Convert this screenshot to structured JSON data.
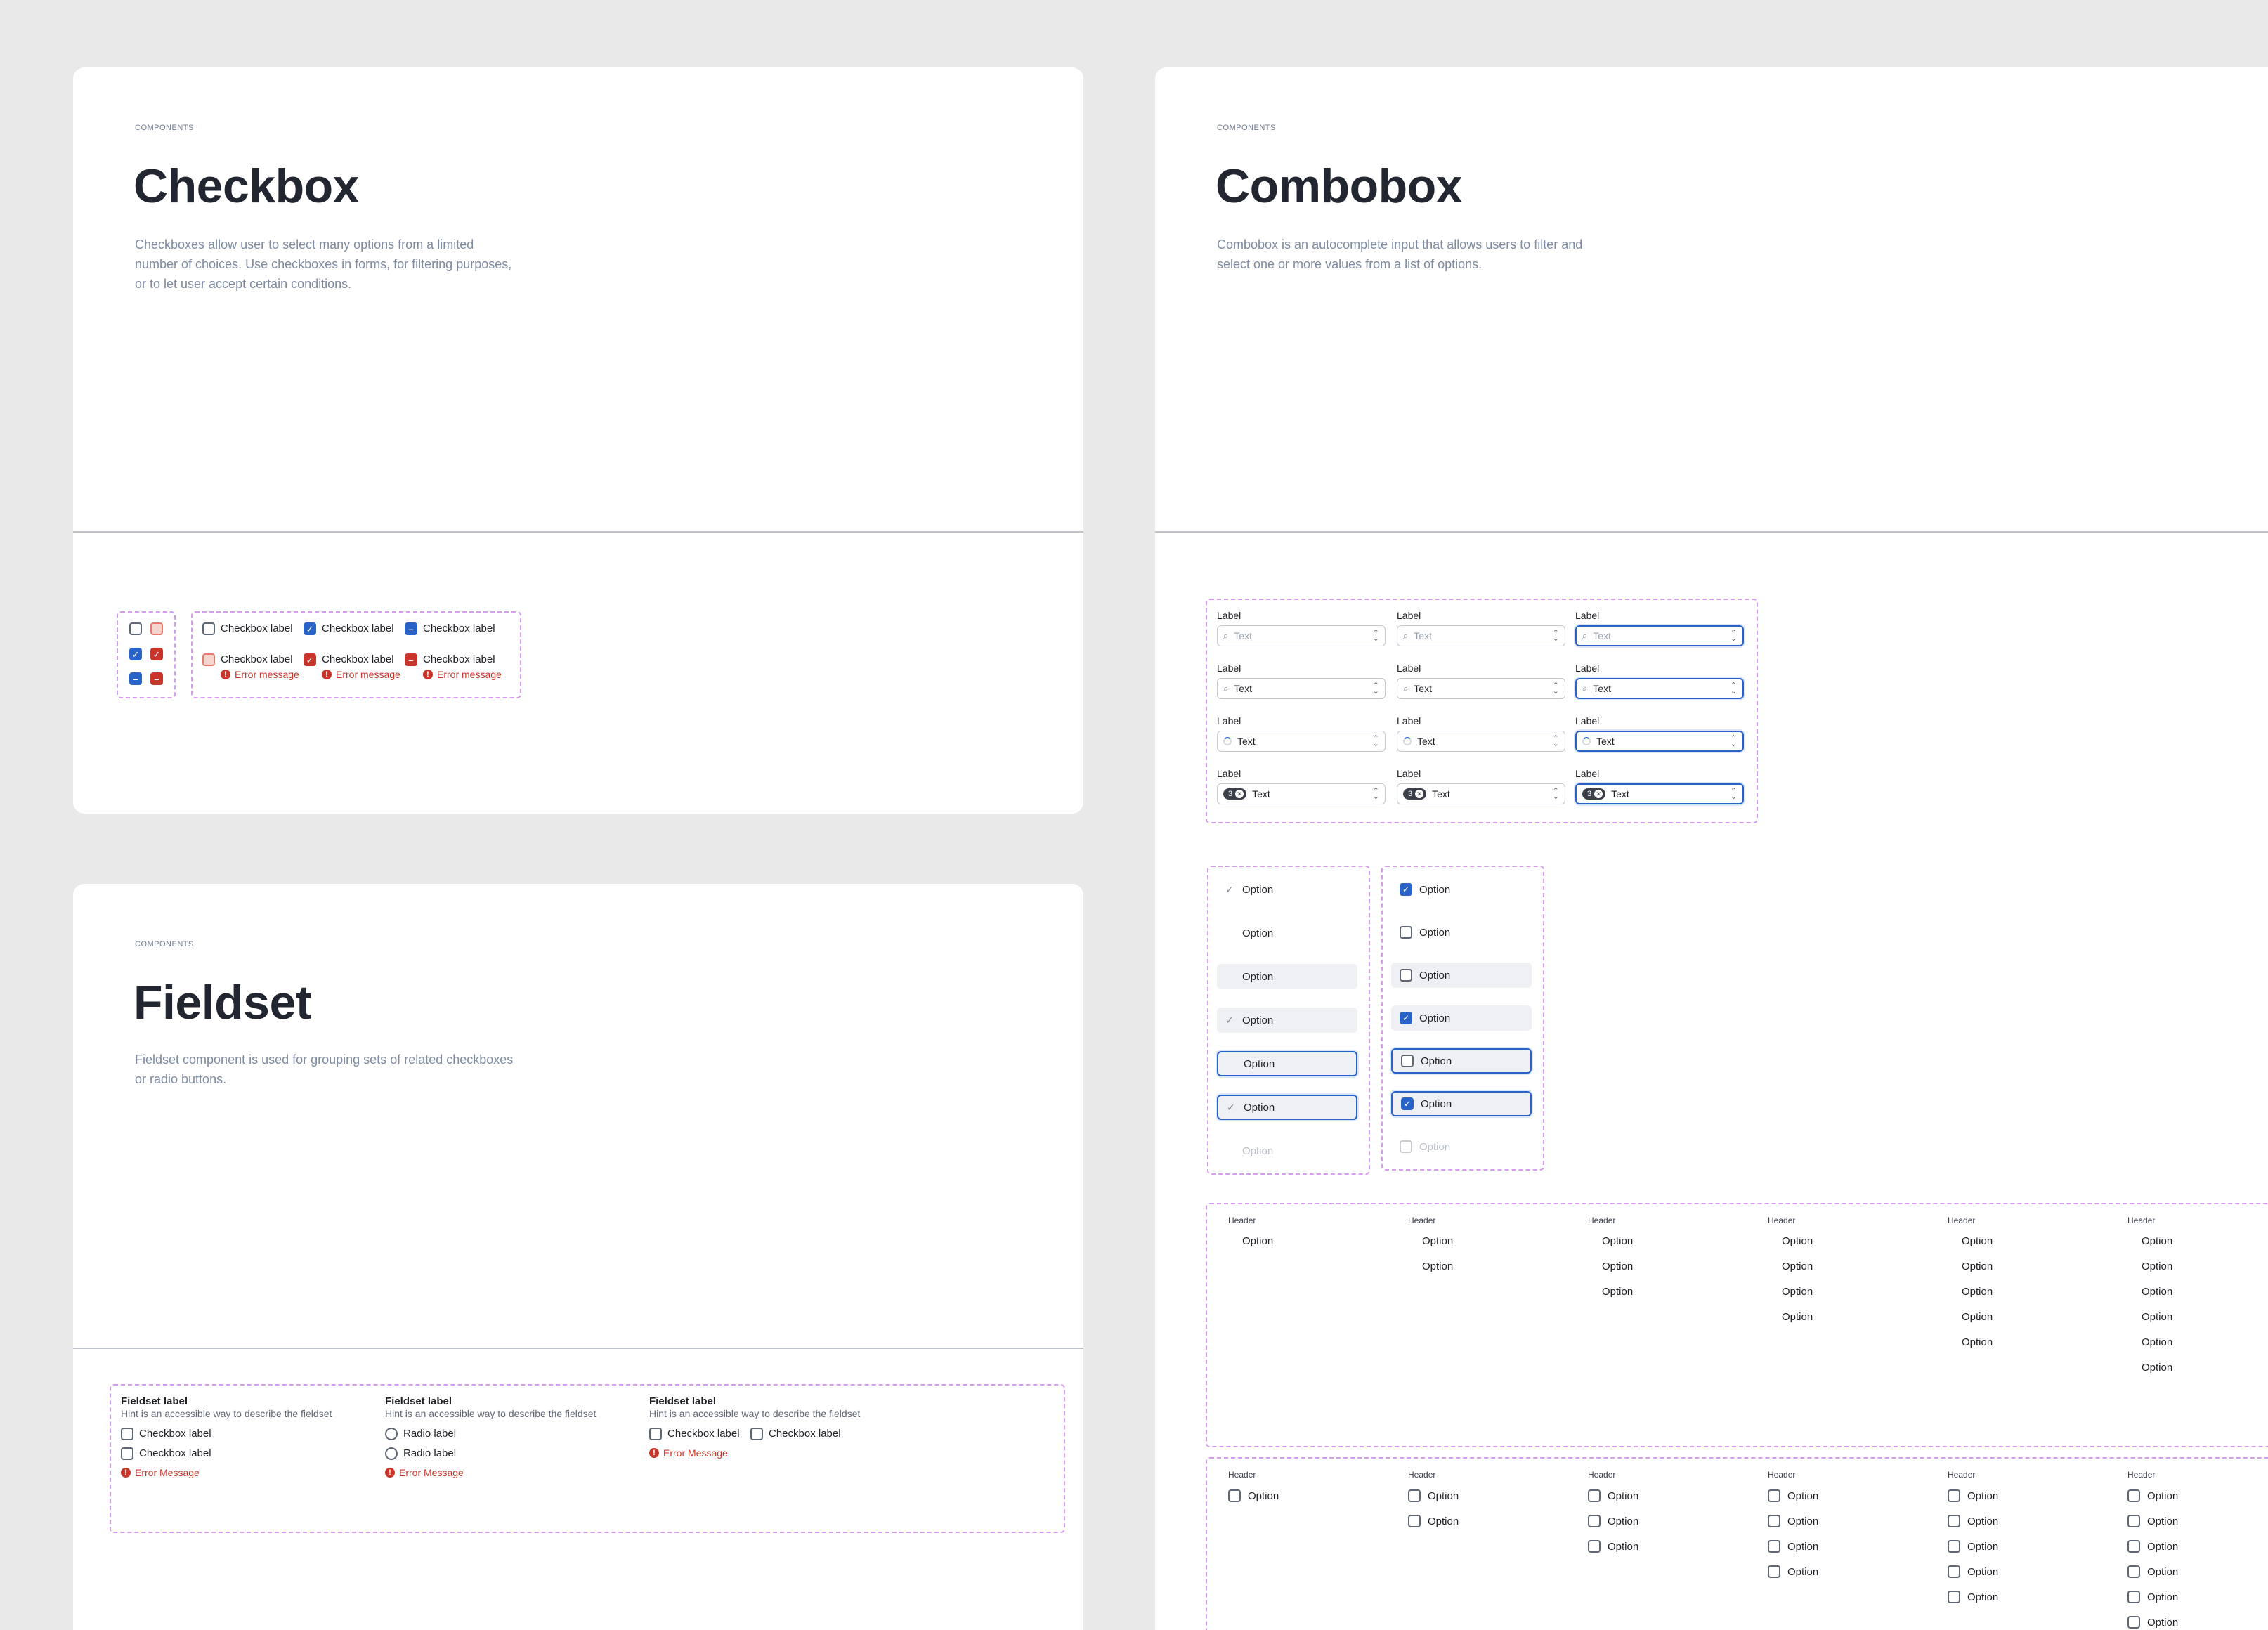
{
  "cards": {
    "checkbox": {
      "eyebrow": "COMPONENTS",
      "title": "Checkbox",
      "desc": [
        "Checkboxes allow user to select many options from a limited",
        "number of choices. Use checkboxes in forms, for filtering purposes,",
        "or to let user accept certain conditions."
      ],
      "label": "Checkbox label",
      "error": "Error message"
    },
    "combobox": {
      "eyebrow": "COMPONENTS",
      "title": "Combobox",
      "desc": [
        "Combobox is an autocomplete input that allows users to filter and",
        "select one or more values from a list of options."
      ],
      "field_label": "Label",
      "placeholder": "Text",
      "value": "Text",
      "badge_count": "3",
      "option": "Option",
      "header": "Header"
    },
    "fieldset": {
      "eyebrow": "COMPONENTS",
      "title": "Fieldset",
      "desc": [
        "Fieldset component is used for grouping sets of related checkboxes",
        "or radio buttons."
      ],
      "fieldset_label": "Fieldset label",
      "hint": "Hint is an accessible way to describe the fieldset",
      "checkbox_label": "Checkbox label",
      "radio_label": "Radio label",
      "error": "Error Message"
    }
  },
  "colors": {
    "accent": "#2a63c8",
    "error": "#c8352b",
    "dashed_frame": "#d59cf0",
    "background": "#e9e9e9"
  },
  "icons": {
    "search": "search-icon",
    "chevron": "chevron-updown-icon",
    "check": "check-icon",
    "error": "error-icon",
    "clear": "close-icon"
  }
}
